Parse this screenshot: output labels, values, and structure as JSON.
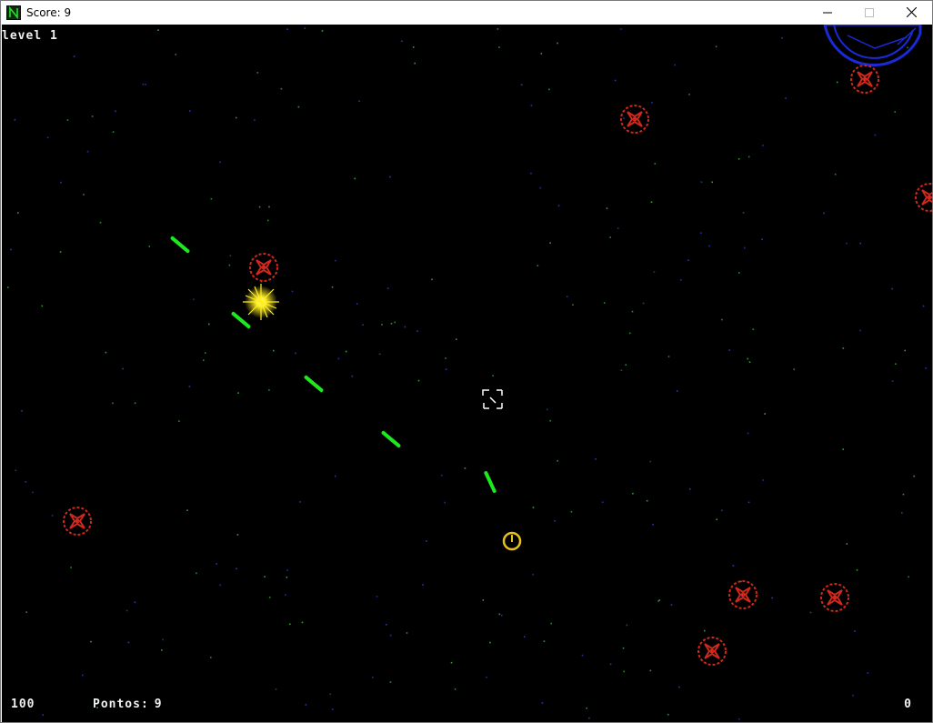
{
  "window": {
    "title": "Score: 9",
    "app_icon": "n-app-icon",
    "controls": [
      "minimize-icon",
      "maximize-icon",
      "close-icon"
    ]
  },
  "hud": {
    "level_label": "level",
    "level_value": "1",
    "health": "100",
    "points_label": "Pontos:",
    "points_value": "9",
    "right_counter": "0"
  },
  "colors": {
    "background": "#000000",
    "enemy": "#d0281c",
    "laser": "#1ee81e",
    "explosion": "#ffee22",
    "player": "#e8c218",
    "planet": "#1a2ad8",
    "hud_text": "#f0f0f0"
  },
  "entities": {
    "player": "yellow-ring-ship",
    "crosshair": "aim-reticle",
    "enemies": "red-mine",
    "lasers": "green-laser-bolt",
    "explosion": "yellow-starburst",
    "planet": "blue-planet"
  }
}
